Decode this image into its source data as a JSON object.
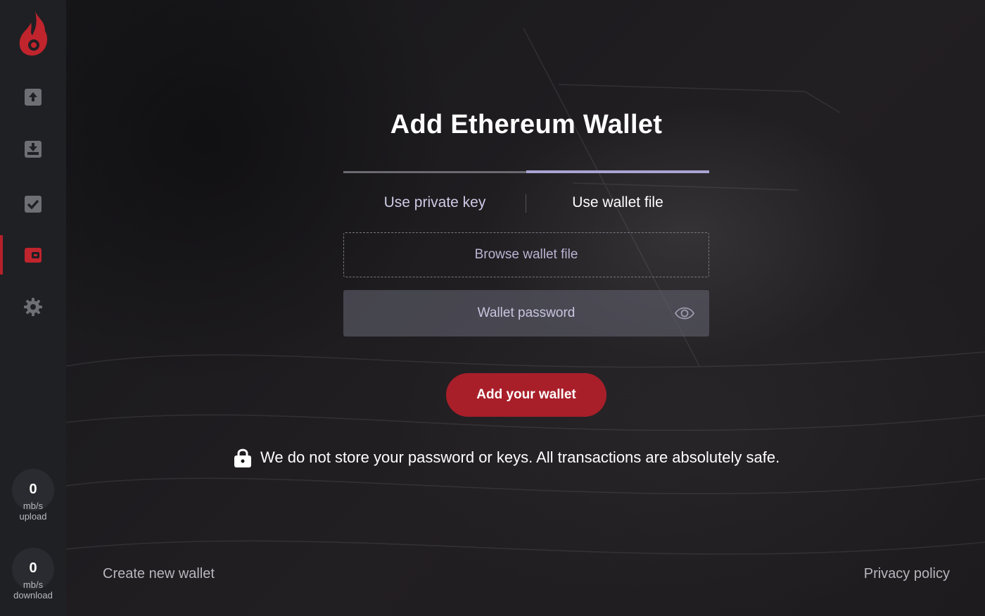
{
  "colors": {
    "accent": "#a81f2a",
    "sidebar_bg": "#1f2024",
    "active_tab_underline": "#a9a3d2",
    "icon_gray": "#6e6f75"
  },
  "sidebar": {
    "items": [
      {
        "name": "upload",
        "icon": "upload-icon",
        "active": false
      },
      {
        "name": "download",
        "icon": "download-icon",
        "active": false
      },
      {
        "name": "tasks",
        "icon": "checkbox-icon",
        "active": false
      },
      {
        "name": "wallet",
        "icon": "wallet-icon",
        "active": true
      },
      {
        "name": "settings",
        "icon": "gear-icon",
        "active": false
      }
    ],
    "upload_speed": {
      "value": "0",
      "unit": "mb/s",
      "label": "upload"
    },
    "download_speed": {
      "value": "0",
      "unit": "mb/s",
      "label": "download"
    }
  },
  "main": {
    "title": "Add Ethereum Wallet",
    "tabs": [
      {
        "label": "Use private key",
        "active": false
      },
      {
        "label": "Use wallet file",
        "active": true
      }
    ],
    "browse_label": "Browse wallet file",
    "password": {
      "placeholder": "Wallet password",
      "value": ""
    },
    "submit_label": "Add your wallet",
    "notice": "We do not store your password or keys. All transactions are absolutely safe."
  },
  "footer": {
    "create_label": "Create new wallet",
    "privacy_label": "Privacy policy"
  }
}
